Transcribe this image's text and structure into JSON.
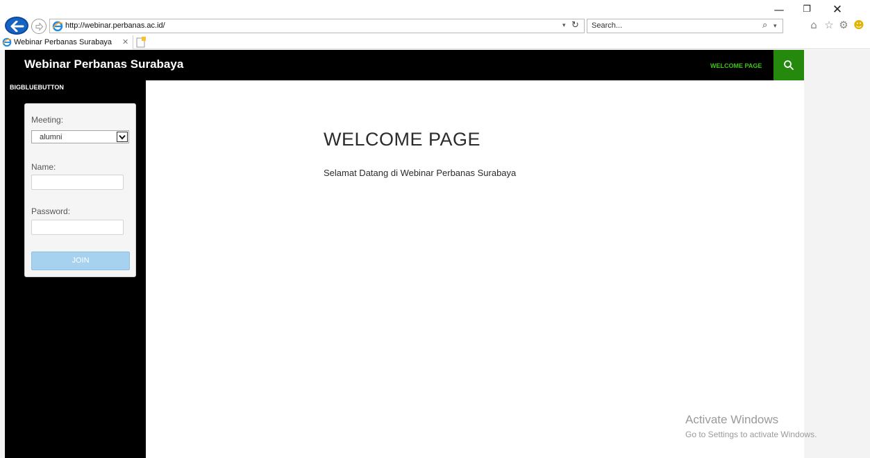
{
  "browser": {
    "window_controls": {
      "minimize": "—",
      "restore": "❐",
      "close": "✕"
    },
    "address": {
      "url": "http://webinar.perbanas.ac.id/",
      "dropdown": "▾",
      "refresh": "↻"
    },
    "search": {
      "placeholder": "Search...",
      "glass": "⌕",
      "dropdown": "▾"
    },
    "toolbar": {
      "home": "⌂",
      "favorites": "☆",
      "tools": "⚙",
      "feedback": "☻"
    },
    "tab": {
      "title": "Webinar Perbanas Surabaya",
      "close": "✕"
    }
  },
  "site": {
    "title": "Webinar Perbanas Surabaya",
    "nav": {
      "welcome": "WELCOME PAGE"
    },
    "accent": "#24890d"
  },
  "sidebar": {
    "widget_title": "BIGBLUEBUTTON",
    "meeting_label": "Meeting:",
    "meeting_value": "alumni",
    "name_label": "Name:",
    "name_value": "",
    "password_label": "Password:",
    "password_value": "",
    "join_label": "JOIN"
  },
  "main": {
    "title": "WELCOME PAGE",
    "text": "Selamat Datang di Webinar Perbanas Surabaya"
  },
  "watermark": {
    "title": "Activate Windows",
    "subtitle": "Go to Settings to activate Windows."
  }
}
